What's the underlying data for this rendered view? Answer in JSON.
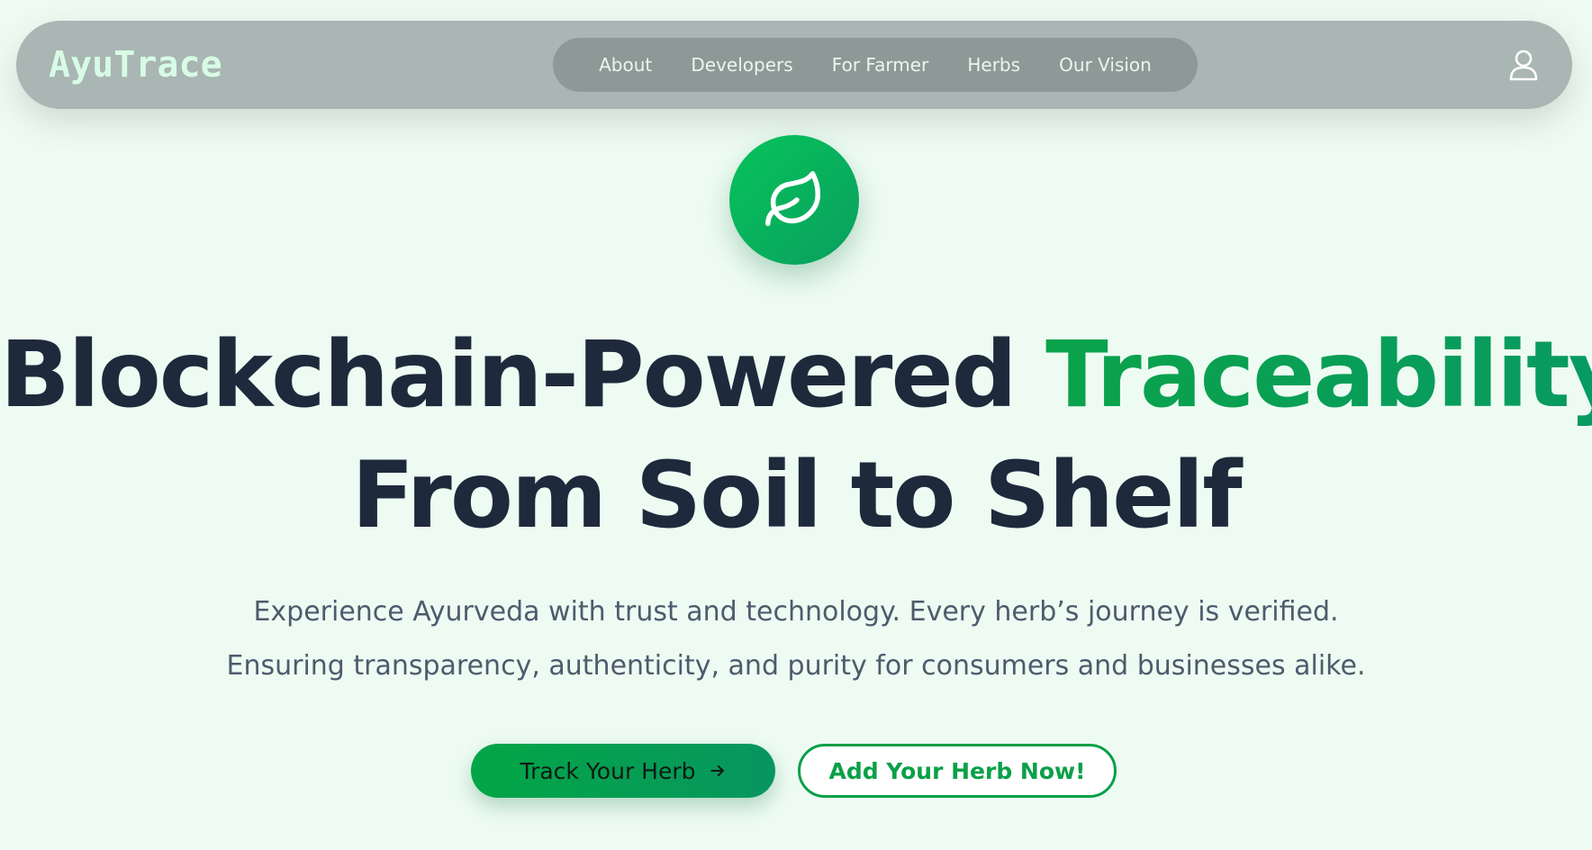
{
  "navbar": {
    "brand": "AyuTrace",
    "links": [
      {
        "label": "About"
      },
      {
        "label": "Developers"
      },
      {
        "label": "For Farmer"
      },
      {
        "label": "Herbs"
      },
      {
        "label": "Our Vision"
      }
    ],
    "user_icon": "user-icon"
  },
  "hero": {
    "logo_icon": "leaf-icon",
    "headline_part1": "Blockchain-Powered ",
    "headline_accent": "Traceability",
    "headline_line2": "From Soil to Shelf",
    "subtext_line1": "Experience Ayurveda with trust and technology. Every herb’s journey is verified.",
    "subtext_line2": "Ensuring transparency, authenticity, and purity for consumers and businesses alike.",
    "primary_button": "Track Your Herb",
    "primary_button_icon": "arrow-right-icon",
    "secondary_button": "Add Your Herb Now!"
  },
  "colors": {
    "background": "#eefbf3",
    "navbar": "#a9b6b3",
    "nav_pill": "#8d9996",
    "brand_text": "#d8fbe6",
    "accent_green": "#0aa048",
    "headline": "#1e2a3b",
    "subtext": "#4e5b6c"
  }
}
